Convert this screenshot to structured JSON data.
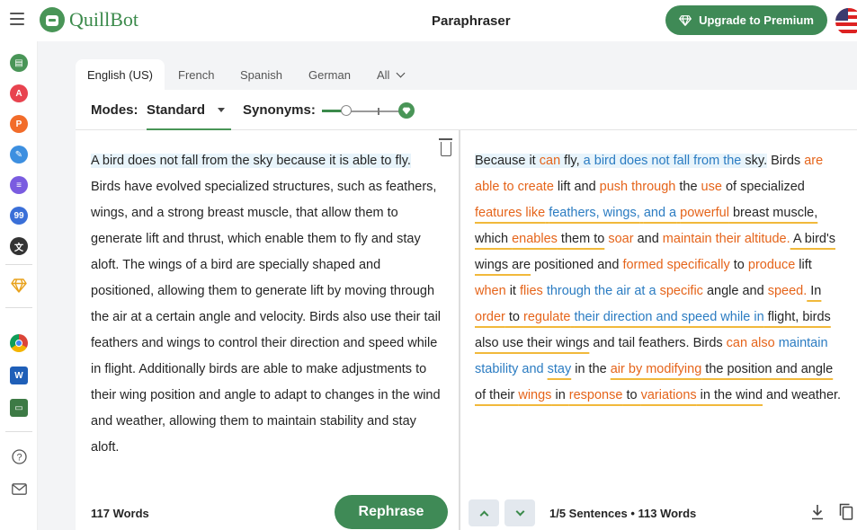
{
  "header": {
    "app_name": "QuillBot",
    "page_title": "Paraphraser",
    "upgrade_label": "Upgrade to Premium"
  },
  "rail": {
    "icons": [
      {
        "name": "paraphraser-icon",
        "color": "#499557",
        "glyph": "▤"
      },
      {
        "name": "grammar-checker-icon",
        "color": "#e8434f",
        "glyph": "A"
      },
      {
        "name": "plagiarism-checker-icon",
        "color": "#f26c2a",
        "glyph": "P"
      },
      {
        "name": "co-writer-icon",
        "color": "#3d8fe0",
        "glyph": "✎"
      },
      {
        "name": "summarizer-icon",
        "color": "#7a5ce0",
        "glyph": "≡"
      },
      {
        "name": "citation-generator-icon",
        "color": "#3a6fd8",
        "glyph": "99"
      },
      {
        "name": "translator-icon",
        "color": "#333333",
        "glyph": "文"
      }
    ]
  },
  "tabs": {
    "languages": [
      "English (US)",
      "French",
      "Spanish",
      "German",
      "All"
    ]
  },
  "modes": {
    "label": "Modes:",
    "selected": "Standard",
    "synonyms_label": "Synonyms:"
  },
  "input": {
    "first_sentence": "A bird does not fall from the sky because it is able to fly.",
    "rest": " Birds have evolved specialized structures, such as feathers, wings, and a strong breast muscle, that allow them to generate lift and thrust, which enable them to fly and stay aloft. The wings of a bird are specially shaped and positioned, allowing them to generate lift by moving through the air at a certain angle and velocity. Birds also use their tail feathers and wings to control their direction and speed while in flight. Additionally birds are able to make adjustments to their wing position and angle to adapt to changes in the wind and weather, allowing them to maintain stability and stay aloft.",
    "word_count": "117 Words",
    "rephrase_label": "Rephrase"
  },
  "output": {
    "segments": [
      {
        "t": "Because it ",
        "c": "hl"
      },
      {
        "t": "can",
        "c": "hl or"
      },
      {
        "t": " fly, ",
        "c": "hl"
      },
      {
        "t": "a bird does not fall from the",
        "c": "hl bl"
      },
      {
        "t": " sky.",
        "c": "hl"
      },
      {
        "t": " Birds ",
        "c": ""
      },
      {
        "t": "are able to",
        "c": "or"
      },
      {
        "t": " ",
        "c": ""
      },
      {
        "t": "create",
        "c": "or"
      },
      {
        "t": " lift and ",
        "c": ""
      },
      {
        "t": "push through",
        "c": "or"
      },
      {
        "t": " the ",
        "c": ""
      },
      {
        "t": "use",
        "c": "or"
      },
      {
        "t": " of specialized ",
        "c": ""
      },
      {
        "t": "features like",
        "c": "or ul"
      },
      {
        "t": " ",
        "c": "ul"
      },
      {
        "t": "feathers, wings,",
        "c": "bl ul"
      },
      {
        "t": " ",
        "c": "ul"
      },
      {
        "t": "and a",
        "c": "bl ul"
      },
      {
        "t": " ",
        "c": "ul"
      },
      {
        "t": "powerful",
        "c": "or ul"
      },
      {
        "t": " breast muscle,",
        "c": "ul"
      },
      {
        "t": " which ",
        "c": "ul"
      },
      {
        "t": "enables",
        "c": "or ul"
      },
      {
        "t": " them to",
        "c": "ul"
      },
      {
        "t": " ",
        "c": ""
      },
      {
        "t": "soar",
        "c": "or"
      },
      {
        "t": " and ",
        "c": ""
      },
      {
        "t": "maintain their altitude.",
        "c": "or"
      },
      {
        "t": " A bird's wings are",
        "c": "ul"
      },
      {
        "t": " positioned and ",
        "c": ""
      },
      {
        "t": "formed specifically",
        "c": "or"
      },
      {
        "t": " to ",
        "c": ""
      },
      {
        "t": "produce",
        "c": "or"
      },
      {
        "t": " lift ",
        "c": ""
      },
      {
        "t": "when",
        "c": "or"
      },
      {
        "t": " it ",
        "c": ""
      },
      {
        "t": "flies",
        "c": "or"
      },
      {
        "t": " ",
        "c": ""
      },
      {
        "t": "through the air at a",
        "c": "bl"
      },
      {
        "t": " ",
        "c": ""
      },
      {
        "t": "specific",
        "c": "or"
      },
      {
        "t": " angle and ",
        "c": ""
      },
      {
        "t": "speed.",
        "c": "or"
      },
      {
        "t": " In ",
        "c": "ul"
      },
      {
        "t": "order",
        "c": "or ul"
      },
      {
        "t": " to ",
        "c": "ul"
      },
      {
        "t": "regulate",
        "c": "or ul"
      },
      {
        "t": " ",
        "c": "ul"
      },
      {
        "t": "their direction and speed while in",
        "c": "bl ul"
      },
      {
        "t": " flight, birds also use their wings",
        "c": "ul"
      },
      {
        "t": " and tail feathers. Birds ",
        "c": ""
      },
      {
        "t": "can also",
        "c": "or"
      },
      {
        "t": " ",
        "c": ""
      },
      {
        "t": "maintain stability and",
        "c": "bl"
      },
      {
        "t": " ",
        "c": ""
      },
      {
        "t": "stay",
        "c": "bl ul"
      },
      {
        "t": " in the ",
        "c": ""
      },
      {
        "t": "air by modifying",
        "c": "or ul"
      },
      {
        "t": " the position and angle of their ",
        "c": "ul"
      },
      {
        "t": "wings",
        "c": "or ul"
      },
      {
        "t": " in ",
        "c": "ul"
      },
      {
        "t": "response",
        "c": "or ul"
      },
      {
        "t": " to ",
        "c": "ul"
      },
      {
        "t": "variations",
        "c": "or ul"
      },
      {
        "t": " in the wind",
        "c": "ul"
      },
      {
        "t": " and weather.",
        "c": ""
      }
    ],
    "sentence_info": "1/5 Sentences • 113 Words"
  },
  "colors": {
    "brand_green": "#3f8a56",
    "changed_word": "#e5641a",
    "structural_change": "#2b7cc2",
    "longest_unchanged": "#f1b93b"
  }
}
